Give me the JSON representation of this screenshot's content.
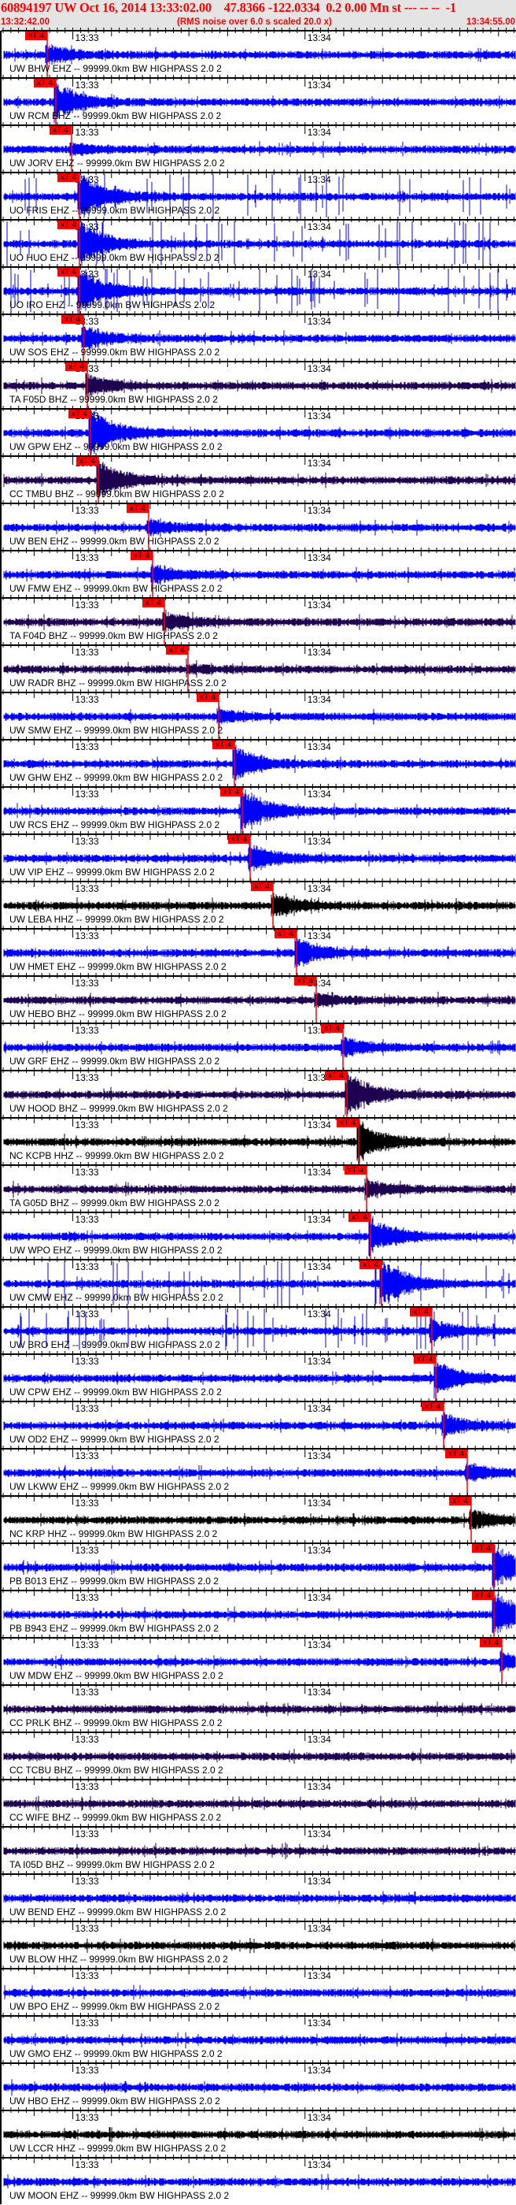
{
  "header": {
    "title": "60894197 UW Oct 16, 2014 13:33:02.00    47.8366 -122.0334  0.2 0.00 Mn st --- -- --  -1",
    "start_time": "13:32:42.00",
    "note": "(RMS noise over 6.0 s scaled 20.0 x)",
    "end_time": "13:34:55.00"
  },
  "chart_data": {
    "type": "line",
    "title": "Seismogram record section, event 60894197",
    "x_range_seconds": [
      0,
      133
    ],
    "x_start": "13:32:42.00",
    "minute_ticks": [
      {
        "label": "13:33",
        "t": 18
      },
      {
        "label": "13:34",
        "t": 78
      }
    ],
    "pick_label": "xT 4",
    "colors": {
      "blue": "#0000ff",
      "purple": "#1e0050",
      "black": "#000000",
      "pick": "#ff0000"
    },
    "channels": [
      {
        "label": "UW BHW EHZ -- 99999.0km BW HIGHPASS 2.0 2",
        "color": "blue",
        "pick_s": 11.4
      },
      {
        "label": "UW RCM EHZ -- 99999.0km BW HIGHPASS 2.0 2",
        "color": "blue",
        "pick_s": 13.6
      },
      {
        "label": "UW JORV EHZ -- 99999.0km BW HIGHPASS 2.0 2",
        "color": "blue",
        "pick_s": 17.7
      },
      {
        "label": "UO FRIS EHZ -- 99999.0km BW HIGHPASS 2.0 2",
        "color": "blue",
        "pick_s": 19.7
      },
      {
        "label": "UO HUO EHZ -- 99999.0km BW HIGHPASS 2.0 2",
        "color": "blue",
        "pick_s": 19.7
      },
      {
        "label": "UO IRO EHZ -- 99999.0km BW HIGHPASS 2.0 2",
        "color": "blue",
        "pick_s": 19.7
      },
      {
        "label": "UW SOS EHZ -- 99999.0km BW HIGHPASS 2.0 2",
        "color": "blue",
        "pick_s": 20.7
      },
      {
        "label": "TA F05D BHZ -- 99999.0km BW HIGHPASS 2.0 2",
        "color": "purple",
        "pick_s": 21.7
      },
      {
        "label": "UW GPW EHZ -- 99999.0km BW HIGHPASS 2.0 2",
        "color": "blue",
        "pick_s": 22.6
      },
      {
        "label": "CC TMBU BHZ -- 99999.0km BW HIGHPASS 2.0 2",
        "color": "purple",
        "pick_s": 24.6
      },
      {
        "label": "UW BEN EHZ -- 99999.0km BW HIGHPASS 2.0 2",
        "color": "blue",
        "pick_s": 37.6
      },
      {
        "label": "UW FMW EHZ -- 99999.0km BW HIGHPASS 2.0 2",
        "color": "blue",
        "pick_s": 38.6
      },
      {
        "label": "TA F04D BHZ -- 99999.0km BW HIGHPASS 2.0 2",
        "color": "purple",
        "pick_s": 41.7
      },
      {
        "label": "UW RADR BHZ -- 99999.0km BW HIGHPASS 2.0 2",
        "color": "purple",
        "pick_s": 47.8
      },
      {
        "label": "UW SMW EHZ -- 99999.0km BW HIGHPASS 2.0 2",
        "color": "blue",
        "pick_s": 55.7
      },
      {
        "label": "UW GHW EHZ -- 99999.0km BW HIGHPASS 2.0 2",
        "color": "blue",
        "pick_s": 59.8
      },
      {
        "label": "UW RCS EHZ -- 99999.0km BW HIGHPASS 2.0 2",
        "color": "blue",
        "pick_s": 61.8
      },
      {
        "label": "UW VIP EHZ -- 99999.0km BW HIGHPASS 2.0 2",
        "color": "blue",
        "pick_s": 63.8
      },
      {
        "label": "UW LEBA HHZ -- 99999.0km BW HIGHPASS 2.0 2",
        "color": "black",
        "pick_s": 69.7
      },
      {
        "label": "UW HMET EHZ -- 99999.0km BW HIGHPASS 2.0 2",
        "color": "blue",
        "pick_s": 75.8
      },
      {
        "label": "UW HEBO BHZ -- 99999.0km BW HIGHPASS 2.0 2",
        "color": "purple",
        "pick_s": 80.9
      },
      {
        "label": "UW GRF EHZ -- 99999.0km BW HIGHPASS 2.0 2",
        "color": "blue",
        "pick_s": 87.8
      },
      {
        "label": "UW HOOD BHZ -- 99999.0km BW HIGHPASS 2.0 2",
        "color": "purple",
        "pick_s": 88.8
      },
      {
        "label": "NC KCPB HHZ -- 99999.0km BW HIGHPASS 2.0 2",
        "color": "black",
        "pick_s": 91.9
      },
      {
        "label": "TA G05D BHZ -- 99999.0km BW HIGHPASS 2.0 2",
        "color": "purple",
        "pick_s": 93.9
      },
      {
        "label": "UW WPO EHZ -- 99999.0km BW HIGHPASS 2.0 2",
        "color": "blue",
        "pick_s": 94.9
      },
      {
        "label": "UW CMW EHZ -- 99999.0km BW HIGHPASS 2.0 2",
        "color": "blue",
        "pick_s": 97.8
      },
      {
        "label": "UW BRO EHZ -- 99999.0km BW HIGHPASS 2.0 2",
        "color": "blue",
        "pick_s": 110.8
      },
      {
        "label": "UW CPW EHZ -- 99999.0km BW HIGHPASS 2.0 2",
        "color": "blue",
        "pick_s": 111.8
      },
      {
        "label": "UW OD2 EHZ -- 99999.0km BW HIGHPASS 2.0 2",
        "color": "blue",
        "pick_s": 113.8
      },
      {
        "label": "UW LKWW EHZ -- 99999.0km BW HIGHPASS 2.0 2",
        "color": "blue",
        "pick_s": 119.9
      },
      {
        "label": "NC KRP HHZ -- 99999.0km BW HIGHPASS 2.0 2",
        "color": "black",
        "pick_s": 120.9
      },
      {
        "label": "PB B013 EHZ -- 99999.0km BW HIGHPASS 2.0 2",
        "color": "blue",
        "pick_s": 126.8
      },
      {
        "label": "PB B943 EHZ -- 99999.0km BW HIGHPASS 2.0 2",
        "color": "blue",
        "pick_s": 126.8
      },
      {
        "label": "UW MDW EHZ -- 99999.0km BW HIGHPASS 2.0 2",
        "color": "blue",
        "pick_s": 128.9
      },
      {
        "label": "CC PRLK BHZ -- 99999.0km BW HIGHPASS 2.0 2",
        "color": "purple",
        "pick_s": null
      },
      {
        "label": "CC TCBU BHZ -- 99999.0km BW HIGHPASS 2.0 2",
        "color": "purple",
        "pick_s": null
      },
      {
        "label": "CC WIFE BHZ -- 99999.0km BW HIGHPASS 2.0 2",
        "color": "purple",
        "pick_s": null
      },
      {
        "label": "TA I05D BHZ -- 99999.0km BW HIGHPASS 2.0 2",
        "color": "purple",
        "pick_s": null
      },
      {
        "label": "UW BEND EHZ -- 99999.0km BW HIGHPASS 2.0 2",
        "color": "blue",
        "pick_s": null
      },
      {
        "label": "UW BLOW HHZ -- 99999.0km BW HIGHPASS 2.0 2",
        "color": "black",
        "pick_s": null
      },
      {
        "label": "UW BPO EHZ -- 99999.0km BW HIGHPASS 2.0 2",
        "color": "blue",
        "pick_s": null
      },
      {
        "label": "UW GMO EHZ -- 99999.0km BW HIGHPASS 2.0 2",
        "color": "blue",
        "pick_s": null
      },
      {
        "label": "UW HBO EHZ -- 99999.0km BW HIGHPASS 2.0 2",
        "color": "blue",
        "pick_s": null
      },
      {
        "label": "UW LCCR HHZ -- 99999.0km BW HIGHPASS 2.0 2",
        "color": "black",
        "pick_s": null
      },
      {
        "label": "UW MOON EHZ -- 99999.0km BW HIGHPASS 2.0 2",
        "color": "blue",
        "pick_s": null
      }
    ]
  }
}
